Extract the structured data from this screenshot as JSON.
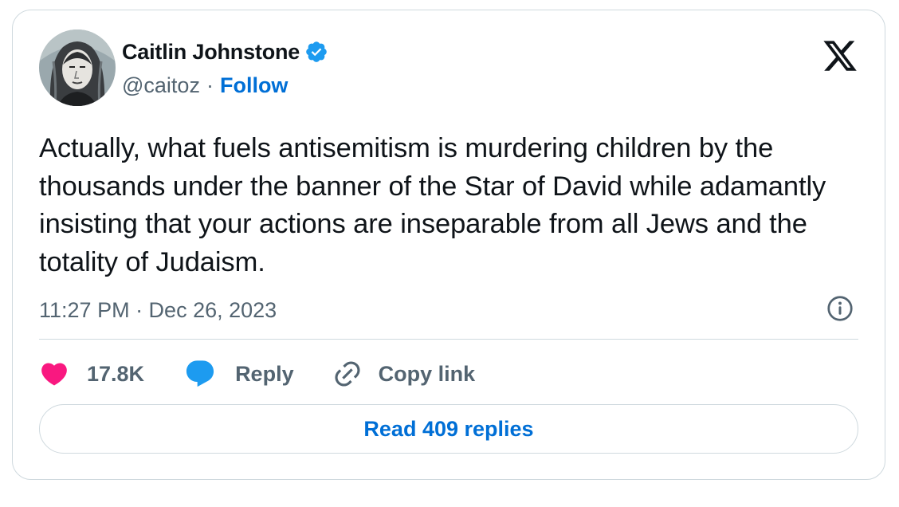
{
  "author": {
    "display_name": "Caitlin Johnstone",
    "handle": "@caitoz",
    "follow_label": "Follow",
    "separator": "·",
    "verified": true
  },
  "tweet": {
    "text": "Actually, what fuels antisemitism is murdering children by the thousands under the banner of the Star of David while adamantly insisting that your actions are inseparable from all Jews and the totality of Judaism.",
    "timestamp": "11:27 PM · Dec 26, 2023"
  },
  "actions": {
    "like_count": "17.8K",
    "reply_label": "Reply",
    "copy_link_label": "Copy link"
  },
  "footer": {
    "read_replies_label": "Read 409 replies"
  },
  "icons": {
    "brand": "x-logo-icon",
    "verified": "verified-badge-icon",
    "info": "info-icon",
    "like": "heart-icon",
    "reply": "speech-bubble-icon",
    "copy_link": "link-icon"
  },
  "colors": {
    "text": "#0f1419",
    "secondary_text": "#536471",
    "link_blue": "#006fd6",
    "verified_blue": "#1d9bf0",
    "like_pink": "#f91880",
    "reply_blue": "#1d9bf0",
    "border": "#cfd9de"
  }
}
